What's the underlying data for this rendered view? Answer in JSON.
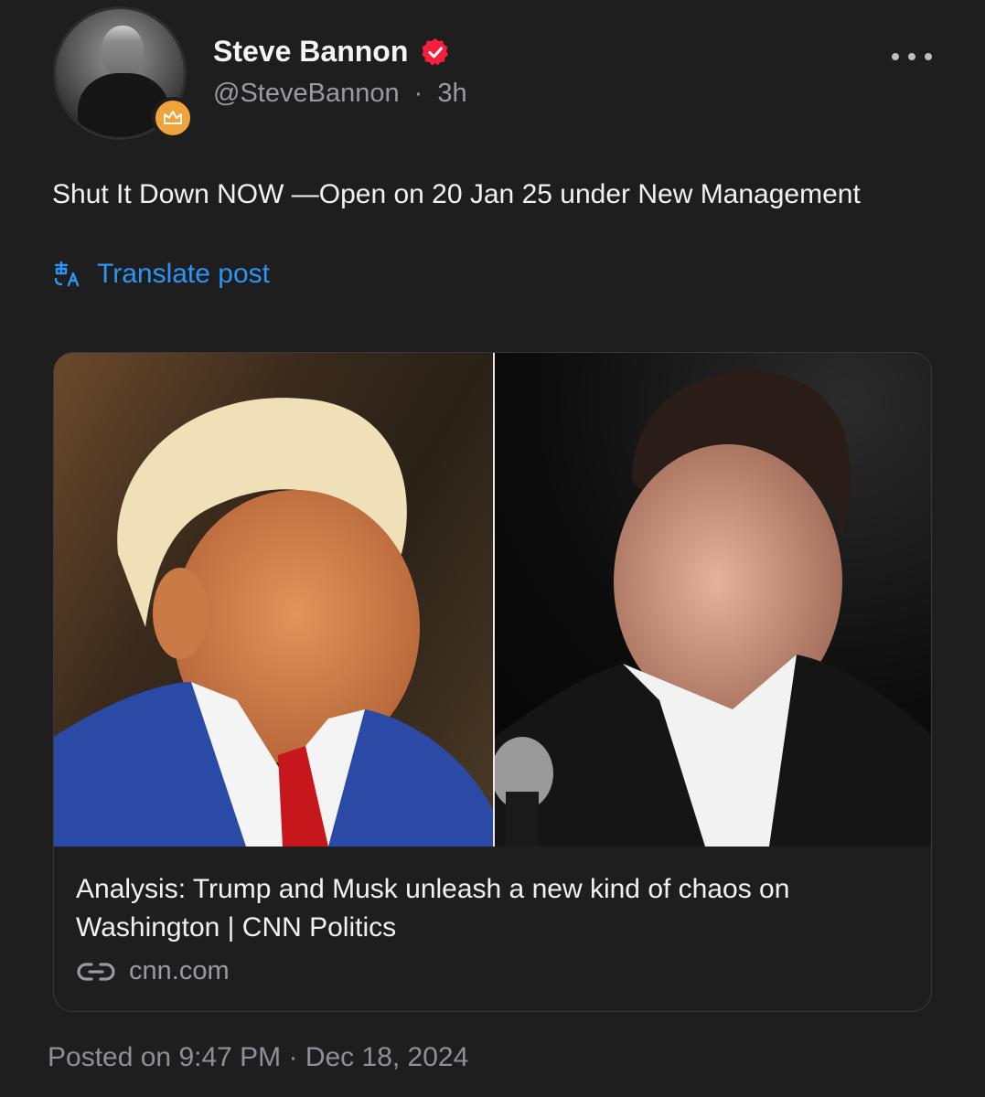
{
  "author": {
    "name": "Steve Bannon",
    "handle": "@SteveBannon",
    "time": "3h",
    "separator": "·"
  },
  "post": {
    "text": "Shut It Down NOW —Open on 20 Jan 25 under New Management",
    "translate_label": "Translate post"
  },
  "link_card": {
    "title": "Analysis: Trump and Musk unleash a new kind of chaos on Washington | CNN Politics",
    "domain": "cnn.com"
  },
  "footer": {
    "posted": "Posted on 9:47 PM · Dec 18, 2024"
  },
  "icons": {
    "verified": "verified-check-icon",
    "badge": "crown-icon",
    "translate": "translate-icon",
    "link": "link-icon",
    "more": "more-horizontal-icon"
  },
  "colors": {
    "background": "#1e1e1f",
    "accent_link": "#2b95f5",
    "verified": "#f91e3b",
    "badge": "#f0a33a"
  }
}
